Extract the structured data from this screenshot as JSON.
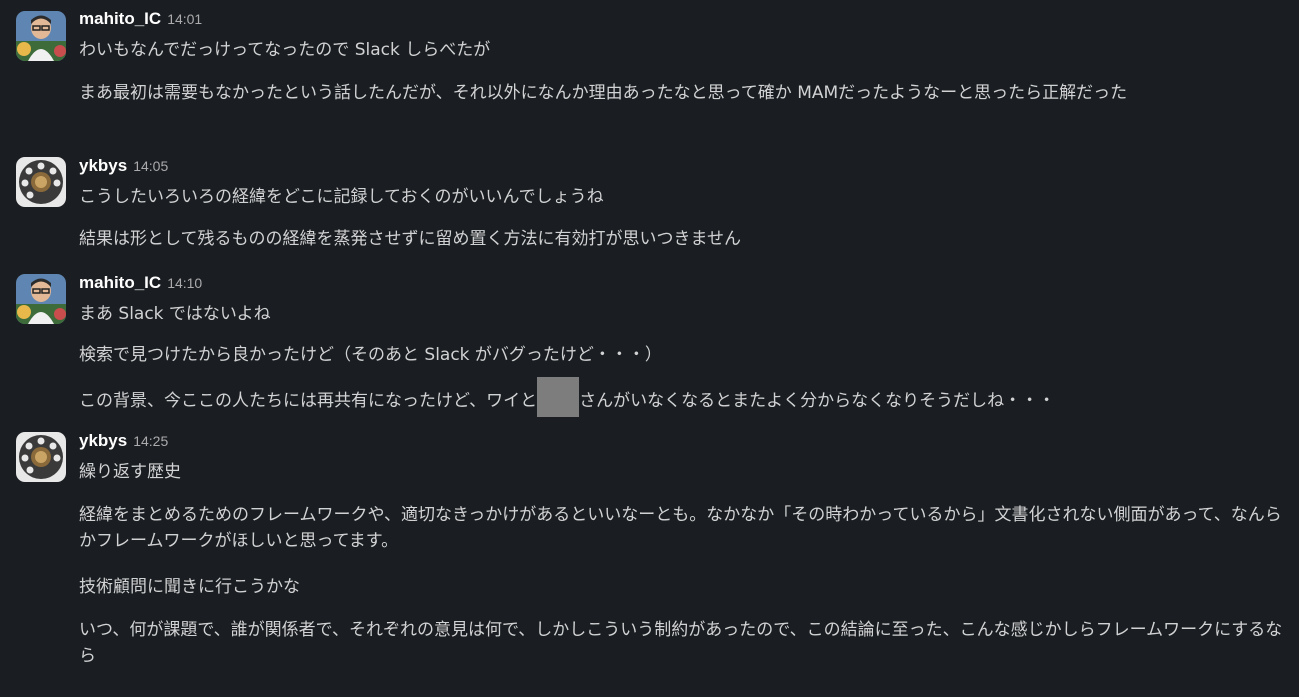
{
  "messages": [
    {
      "author": "mahito_IC",
      "time": "14:01",
      "avatar_icon": "person-photo-avatar",
      "lines": [
        "わいもなんでだっけってなったので Slack しらべたが",
        "まあ最初は需要もなかったという話したんだが、それ以外になんか理由あったなと思って確か MAMだったようなーと思ったら正解だった"
      ]
    },
    {
      "author": "ykbys",
      "time": "14:05",
      "avatar_icon": "rotary-dial-avatar",
      "lines": [
        "こうしたいろいろの経緯をどこに記録しておくのがいいんでしょうね",
        "結果は形として残るものの経緯を蒸発させずに留め置く方法に有効打が思いつきません"
      ]
    },
    {
      "author": "mahito_IC",
      "time": "14:10",
      "avatar_icon": "person-photo-avatar",
      "lines": [
        "まあ Slack ではないよね",
        "検索で見つけたから良かったけど（そのあと Slack がバグったけど・・・）"
      ],
      "redacted_line": {
        "before": "この背景、今ここの人たちには再共有になったけど、ワイと",
        "after": "さんがいなくなるとまたよく分からなくなりそうだしね・・・"
      }
    },
    {
      "author": "ykbys",
      "time": "14:25",
      "avatar_icon": "rotary-dial-avatar",
      "lines": [
        "繰り返す歴史",
        "経緯をまとめるためのフレームワークや、適切なきっかけがあるといいなーとも。なかなか「その時わかっているから」文書化されない側面があって、なんらかフレームワークがほしいと思ってます。",
        "技術顧問に聞きに行こうかな",
        "いつ、何が課題で、誰が関係者で、それぞれの意見は何で、しかしこういう制約があったので、この結論に至った、こんな感じかしらフレームワークにするなら"
      ]
    }
  ],
  "colors": {
    "background": "#1a1d21",
    "text": "#d1d2d3",
    "author": "#ffffff",
    "timestamp": "#ababad",
    "redaction": "#7d7d7d"
  }
}
